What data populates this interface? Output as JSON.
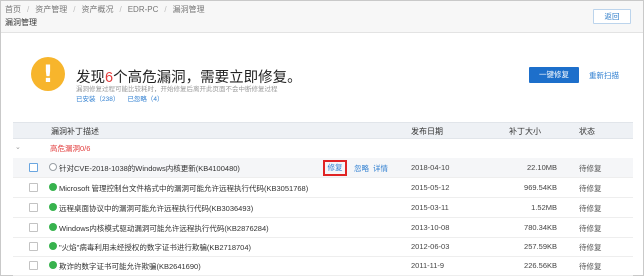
{
  "breadcrumb": [
    "首页",
    "资产管理",
    "资产概况",
    "EDR-PC",
    "漏洞管理"
  ],
  "page_title": "漏洞管理",
  "back_label": "返回",
  "summary": {
    "headline_prefix": "发现",
    "headline_count": "6",
    "headline_suffix": "个高危漏洞，需要立即修复。",
    "subtext": "漏洞修复过程可能比较耗时，开始修复后离开此页面不会中断修复过程",
    "stat_installed": "已安装（238）",
    "stat_ignored": "已忽略（4）"
  },
  "buttons": {
    "one_click_repair": "一键修复",
    "rescan": "重新扫描"
  },
  "table": {
    "columns": {
      "name": "漏洞补丁描述",
      "date": "发布日期",
      "size": "补丁大小",
      "status": "状态"
    },
    "group_label": "高危漏洞0/6",
    "row_actions": {
      "repair": "修复",
      "ignore": "忽略",
      "detail": "详情"
    },
    "rows": [
      {
        "name": "针对CVE-2018-1038的Windows内核更新(KB4100480)",
        "date": "2018-04-10",
        "size": "22.10MB",
        "status": "待修复",
        "icon": "outline-circle-icon"
      },
      {
        "name": "Microsoft 管理控制台文件格式中的漏洞可能允许远程执行代码(KB3051768)",
        "date": "2015-05-12",
        "size": "969.54KB",
        "status": "待修复",
        "icon": "green-shield-icon"
      },
      {
        "name": "远程桌面协议中的漏洞可能允许远程执行代码(KB3036493)",
        "date": "2015-03-11",
        "size": "1.52MB",
        "status": "待修复",
        "icon": "green-shield-icon"
      },
      {
        "name": "Windows内核模式驱动漏洞可能允许远程执行代码(KB2876284)",
        "date": "2013-10-08",
        "size": "780.34KB",
        "status": "待修复",
        "icon": "green-shield-icon"
      },
      {
        "name": "\"火焰\"病毒利用未经授权的数字证书进行欺骗(KB2718704)",
        "date": "2012-06-03",
        "size": "257.59KB",
        "status": "待修复",
        "icon": "green-shield-icon"
      },
      {
        "name": "欺诈的数字证书可能允许欺骗(KB2641690)",
        "date": "2011-11-9",
        "size": "226.56KB",
        "status": "待修复",
        "icon": "green-shield-icon"
      }
    ]
  },
  "colors": {
    "accent_blue": "#1d6fcb",
    "danger_red": "#e23c3c",
    "warn_orange": "#f7b52c",
    "ok_green": "#37b24d"
  }
}
